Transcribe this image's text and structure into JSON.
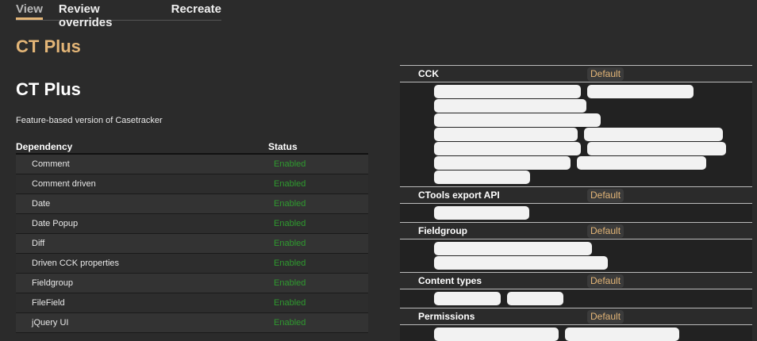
{
  "tabs": [
    {
      "label": "View",
      "active": true
    },
    {
      "label": "Review overrides",
      "active": false
    },
    {
      "label": "Recreate",
      "active": false
    }
  ],
  "page_title": "CT Plus",
  "feature": {
    "title": "CT Plus",
    "description": "Feature-based version of Casetracker"
  },
  "dependency_table": {
    "columns": [
      "Dependency",
      "Status"
    ],
    "rows": [
      {
        "name": "Comment",
        "status": "Enabled"
      },
      {
        "name": "Comment driven",
        "status": "Enabled"
      },
      {
        "name": "Date",
        "status": "Enabled"
      },
      {
        "name": "Date Popup",
        "status": "Enabled"
      },
      {
        "name": "Diff",
        "status": "Enabled"
      },
      {
        "name": "Driven CCK properties",
        "status": "Enabled"
      },
      {
        "name": "Fieldgroup",
        "status": "Enabled"
      },
      {
        "name": "FileField",
        "status": "Enabled"
      },
      {
        "name": "jQuery UI",
        "status": "Enabled"
      }
    ]
  },
  "components": [
    {
      "name": "CCK",
      "state": "Default"
    },
    {
      "name": "CTools export API",
      "state": "Default"
    },
    {
      "name": "Fieldgroup",
      "state": "Default"
    },
    {
      "name": "Content types",
      "state": "Default"
    },
    {
      "name": "Permissions",
      "state": "Default"
    }
  ],
  "colors": {
    "accent": "#e3b577",
    "enabled": "#2f9a2f",
    "background": "#2b2b2b"
  }
}
